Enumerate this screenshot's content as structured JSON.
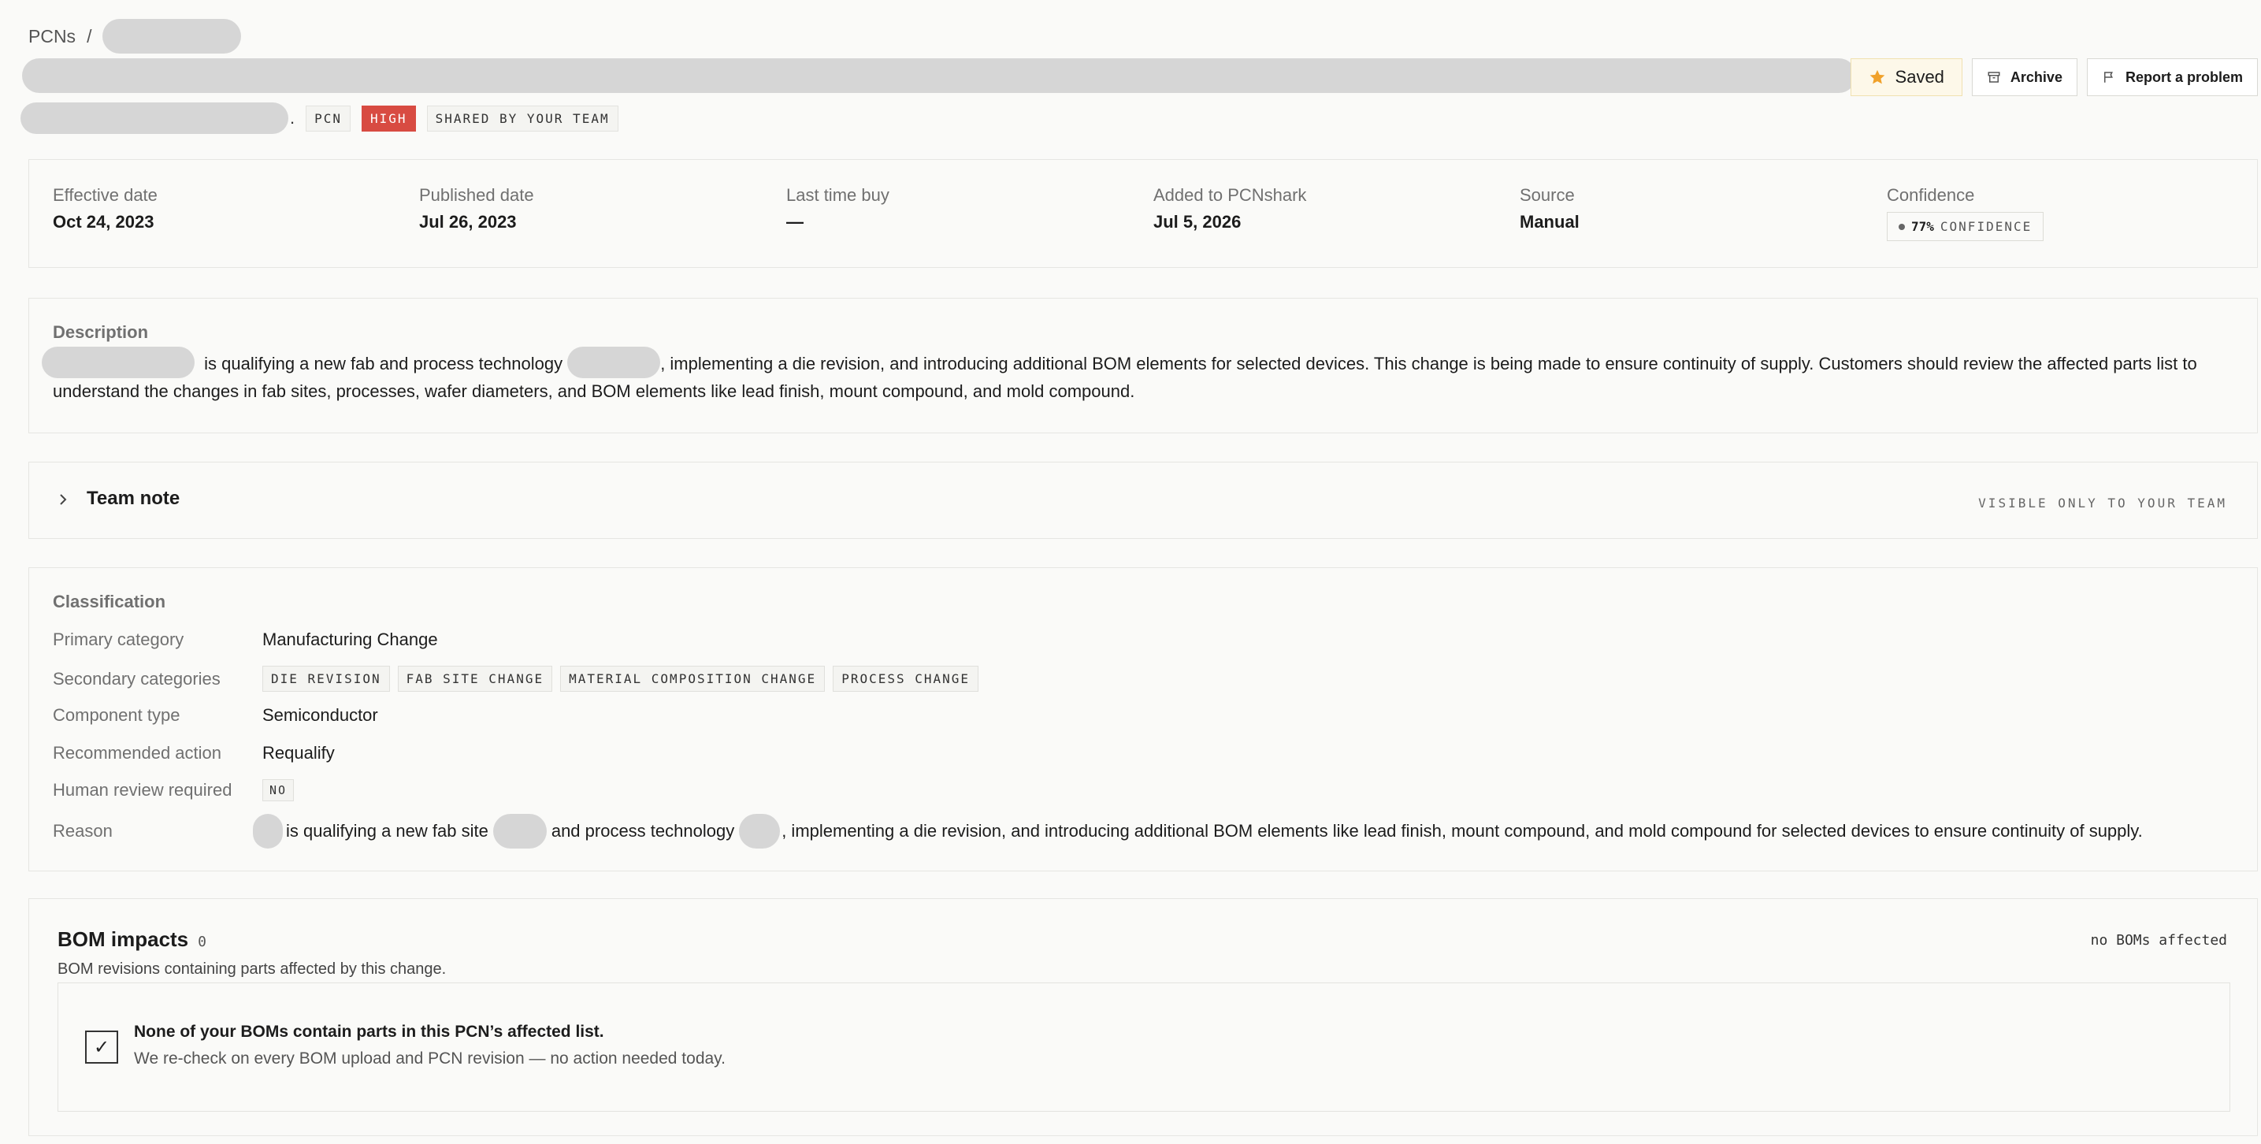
{
  "breadcrumb": {
    "root": "PCNs",
    "separator": "/"
  },
  "meta": {
    "trailing_punct": ".",
    "chips": {
      "type": "PCN",
      "severity": "HIGH",
      "shared": "SHARED BY YOUR TEAM"
    }
  },
  "actions": {
    "saved": "Saved",
    "archive": "Archive",
    "report": "Report a problem"
  },
  "stats": {
    "effective": {
      "label": "Effective date",
      "value": "Oct 24, 2023"
    },
    "published": {
      "label": "Published date",
      "value": "Jul 26, 2023"
    },
    "ltb": {
      "label": "Last time buy",
      "value": "—"
    },
    "added": {
      "label": "Added to PCNshark",
      "value": "Jul 5, 2026"
    },
    "source": {
      "label": "Source",
      "value": "Manual"
    },
    "confidence": {
      "label": "Confidence",
      "pct": "77%",
      "word": "CONFIDENCE"
    }
  },
  "description": {
    "label": "Description",
    "part1": " is qualifying a new fab and process technology ",
    "part2": ", implementing a die revision, and introducing additional BOM elements for selected devices. This change is being made to ensure continuity of supply. Customers should review the affected parts list to understand the changes in fab sites, processes, wafer diameters, and BOM elements like lead finish, mount compound, and mold compound."
  },
  "team_note": {
    "title": "Team note",
    "visibility": "VISIBLE ONLY TO YOUR TEAM"
  },
  "classification": {
    "label": "Classification",
    "primary_label": "Primary category",
    "primary": "Manufacturing Change",
    "secondary_label": "Secondary categories",
    "secondary": [
      "DIE REVISION",
      "FAB SITE CHANGE",
      "MATERIAL COMPOSITION CHANGE",
      "PROCESS CHANGE"
    ],
    "component_label": "Component type",
    "component": "Semiconductor",
    "action_label": "Recommended action",
    "action": "Requalify",
    "review_label": "Human review required",
    "review": "NO",
    "reason_label": "Reason",
    "reason1": "is qualifying a new fab site",
    "reason2": "and process technology",
    "reason3": ", implementing a die revision, and introducing additional BOM elements like lead finish, mount compound, and mold compound for selected devices to ensure continuity of supply."
  },
  "bom": {
    "title": "BOM impacts",
    "count": "0",
    "right": "no BOMs affected",
    "subtitle": "BOM revisions containing parts affected by this change.",
    "empty_title": "None of your BOMs contain parts in this PCN’s affected list.",
    "empty_body": "We re-check on every BOM upload and PCN revision — no action needed today.",
    "check": "✓"
  },
  "colors": {
    "high": "#d84b42",
    "saved_star": "#f0a12a",
    "background": "#fafaf8"
  }
}
